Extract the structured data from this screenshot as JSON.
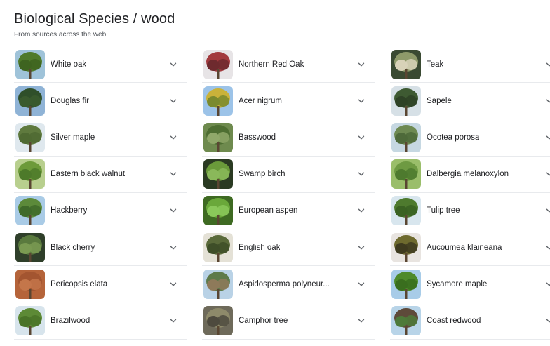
{
  "header": {
    "title": "Biological Species / wood",
    "subtitle": "From sources across the web"
  },
  "columns": [
    {
      "items": [
        {
          "label": "White oak",
          "icon": "white-oak-thumb",
          "colors": [
            "#9fc3d9",
            "#4f7a2a",
            "#3e6420"
          ]
        },
        {
          "label": "Douglas fir",
          "icon": "douglas-fir-thumb",
          "colors": [
            "#8fb3d6",
            "#2f4f2a",
            "#3a5a2e"
          ]
        },
        {
          "label": "Silver maple",
          "icon": "silver-maple-thumb",
          "colors": [
            "#dfe8ee",
            "#5f7a3e",
            "#4f6a32"
          ]
        },
        {
          "label": "Eastern black walnut",
          "icon": "eastern-black-walnut-thumb",
          "colors": [
            "#b8cf8e",
            "#6d9a3a",
            "#4d7a2a"
          ]
        },
        {
          "label": "Hackberry",
          "icon": "hackberry-thumb",
          "colors": [
            "#a9cbe6",
            "#5c8a3a",
            "#3f6a2a"
          ]
        },
        {
          "label": "Black cherry",
          "icon": "black-cherry-thumb",
          "colors": [
            "#2f3f2a",
            "#5a7a3e",
            "#7a9a52"
          ]
        },
        {
          "label": "Pericopsis elata",
          "icon": "pericopsis-elata-thumb",
          "colors": [
            "#b5643a",
            "#a35530",
            "#c4764a"
          ]
        },
        {
          "label": "Brazilwood",
          "icon": "brazilwood-thumb",
          "colors": [
            "#d7e4ec",
            "#5d8a36",
            "#4a7328"
          ]
        }
      ]
    },
    {
      "items": [
        {
          "label": "Northern Red Oak",
          "icon": "northern-red-oak-thumb",
          "colors": [
            "#e7e4e6",
            "#a23a3e",
            "#6e2a2e"
          ]
        },
        {
          "label": "Acer nigrum",
          "icon": "acer-nigrum-thumb",
          "colors": [
            "#9cc3e8",
            "#c9b23a",
            "#7a8a2e"
          ]
        },
        {
          "label": "Basswood",
          "icon": "basswood-thumb",
          "colors": [
            "#6e8a4e",
            "#4e6e32",
            "#90a86a"
          ]
        },
        {
          "label": "Swamp birch",
          "icon": "swamp-birch-thumb",
          "colors": [
            "#2a3a22",
            "#6a9a3a",
            "#8ab85a"
          ]
        },
        {
          "label": "European aspen",
          "icon": "european-aspen-thumb",
          "colors": [
            "#3e6a22",
            "#6aa83a",
            "#8ac85a"
          ]
        },
        {
          "label": "English oak",
          "icon": "english-oak-thumb",
          "colors": [
            "#e4e1d6",
            "#5a6a3a",
            "#3e4e28"
          ]
        },
        {
          "label": "Aspidosperma polyneur...",
          "icon": "aspidosperma-thumb",
          "colors": [
            "#b9d2e6",
            "#5e7a4a",
            "#8e7a5a"
          ]
        },
        {
          "label": "Camphor tree",
          "icon": "camphor-tree-thumb",
          "colors": [
            "#6e6a5a",
            "#8e8a6a",
            "#4e4a3e"
          ]
        }
      ]
    },
    {
      "items": [
        {
          "label": "Teak",
          "icon": "teak-thumb",
          "colors": [
            "#3a4a32",
            "#8e9a6a",
            "#d8d2b8"
          ]
        },
        {
          "label": "Sapele",
          "icon": "sapele-thumb",
          "colors": [
            "#d6e0e6",
            "#3e5a32",
            "#2e4226"
          ]
        },
        {
          "label": "Ocotea porosa",
          "icon": "ocotea-porosa-thumb",
          "colors": [
            "#c6d8e2",
            "#6e8a52",
            "#4e6a3a"
          ]
        },
        {
          "label": "Dalbergia melanoxylon",
          "icon": "dalbergia-thumb",
          "colors": [
            "#9abe6a",
            "#6e9a42",
            "#4e7a2e"
          ]
        },
        {
          "label": "Tulip tree",
          "icon": "tulip-tree-thumb",
          "colors": [
            "#d8e6ee",
            "#4e7a2e",
            "#3a6222"
          ]
        },
        {
          "label": "Aucoumea klaineana",
          "icon": "aucoumea-thumb",
          "colors": [
            "#e8e4e0",
            "#6e6a2e",
            "#3e3a1e"
          ]
        },
        {
          "label": "Sycamore maple",
          "icon": "sycamore-maple-thumb",
          "colors": [
            "#a8cce8",
            "#4e8a2a",
            "#3a6e1e"
          ]
        },
        {
          "label": "Coast redwood",
          "icon": "coast-redwood-thumb",
          "colors": [
            "#b8d4e8",
            "#5e4a3a",
            "#4e7a3a"
          ]
        }
      ]
    }
  ]
}
